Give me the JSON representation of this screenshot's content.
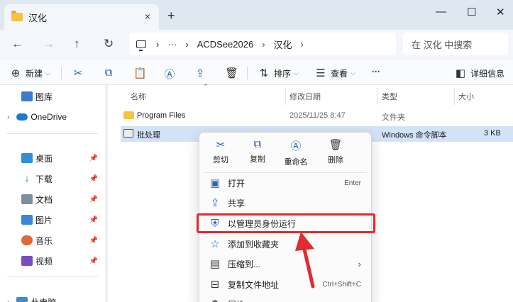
{
  "window": {
    "tab_title": "汉化",
    "tab_close": "×",
    "new_tab": "+",
    "minimize": "—",
    "maximize": "☐",
    "close": "✕"
  },
  "nav": {
    "back": "←",
    "forward": "→",
    "up": "↑",
    "refresh": "↻",
    "breadcrumb": [
      "ACDSee2026",
      "汉化"
    ],
    "breadcrumb_more": "···",
    "sep": "›",
    "search_placeholder": "在 汉化 中搜索"
  },
  "toolbar": {
    "new_label": "新建",
    "sort_label": "排序",
    "view_label": "查看",
    "more": "···",
    "details_label": "详细信息"
  },
  "sidebar": {
    "items": [
      {
        "label": "图库",
        "icon": "gallery-icon"
      },
      {
        "label": "OneDrive",
        "icon": "onedrive-icon"
      },
      {
        "label": "桌面",
        "icon": "desktop-icon"
      },
      {
        "label": "下载",
        "icon": "download-icon"
      },
      {
        "label": "文档",
        "icon": "documents-icon"
      },
      {
        "label": "图片",
        "icon": "pictures-icon"
      },
      {
        "label": "音乐",
        "icon": "music-icon"
      },
      {
        "label": "视频",
        "icon": "videos-icon"
      },
      {
        "label": "此电脑",
        "icon": "this-pc-icon"
      }
    ]
  },
  "columns": {
    "name": "名称",
    "date": "修改日期",
    "type": "类型",
    "size": "大小"
  },
  "files": [
    {
      "name": "Program Files",
      "date": "2025/11/25 8:47",
      "type": "文件夹",
      "size": ""
    },
    {
      "name": "批处理",
      "date": "",
      "type": "Windows 命令脚本",
      "size": "3 KB"
    }
  ],
  "context_menu": {
    "actions": [
      {
        "label": "剪切",
        "icon": "cut-icon"
      },
      {
        "label": "复制",
        "icon": "copy-icon"
      },
      {
        "label": "重命名",
        "icon": "rename-icon"
      },
      {
        "label": "删除",
        "icon": "delete-icon"
      }
    ],
    "items": [
      {
        "label": "打开",
        "shortcut": "Enter"
      },
      {
        "label": "共享",
        "shortcut": ""
      },
      {
        "label": "以管理员身份运行",
        "shortcut": ""
      },
      {
        "label": "添加到收藏夹",
        "shortcut": ""
      },
      {
        "label": "压缩到...",
        "shortcut": "›"
      },
      {
        "label": "复制文件地址",
        "shortcut": "Ctrl+Shift+C"
      },
      {
        "label": "属性",
        "shortcut": ""
      }
    ]
  },
  "colors": {
    "highlight": "#e02b2f",
    "accent": "#2a62b5",
    "selection": "#d3e3f7"
  }
}
